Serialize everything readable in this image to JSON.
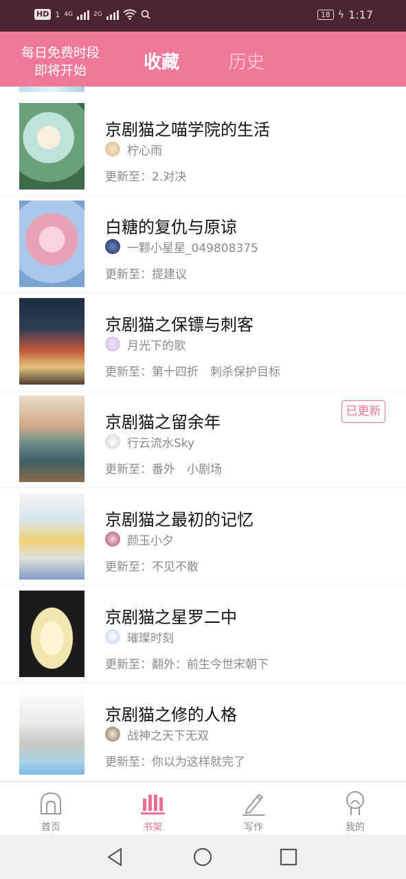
{
  "status_bar": {
    "hd_badge": "HD",
    "hd_sub": "1",
    "net1": "4G",
    "net2": "2G",
    "battery": "18",
    "time": "1:17"
  },
  "header": {
    "promo_line1": "每日免费时段",
    "promo_line2": "即将开始",
    "tab_favorites": "收藏",
    "tab_history": "历史"
  },
  "items": [
    {
      "title": "京剧猫之喵学院的生活",
      "author": "柠心雨",
      "update": "更新至：2.对决"
    },
    {
      "title": "白糖的复仇与原谅",
      "author": "一颗小星星_049808375",
      "update": "更新至：提建议"
    },
    {
      "title": "京剧猫之保镖与刺客",
      "author": "月光下的歌",
      "update": "更新至：第十四折　刺杀保护目标"
    },
    {
      "title": "京剧猫之留余年",
      "author": "行云流水Sky",
      "update": "更新至：番外　小剧场",
      "badge": "已更新"
    },
    {
      "title": "京剧猫之最初的记忆",
      "author": "颜玉小夕",
      "update": "更新至：不见不散"
    },
    {
      "title": "京剧猫之星罗二中",
      "author": "璀璨时刻",
      "update": "更新至：翻外：前生今世宋朝下"
    },
    {
      "title": "京剧猫之修的人格",
      "author": "战神之天下无双",
      "update": "更新至：你以为这样就完了"
    }
  ],
  "bottom_nav": {
    "home": "首页",
    "bookshelf": "书架",
    "write": "写作",
    "mine": "我的"
  },
  "colors": {
    "accent": "#ef7997",
    "status_bar": "#4a2430",
    "badge": "#e7768f"
  }
}
